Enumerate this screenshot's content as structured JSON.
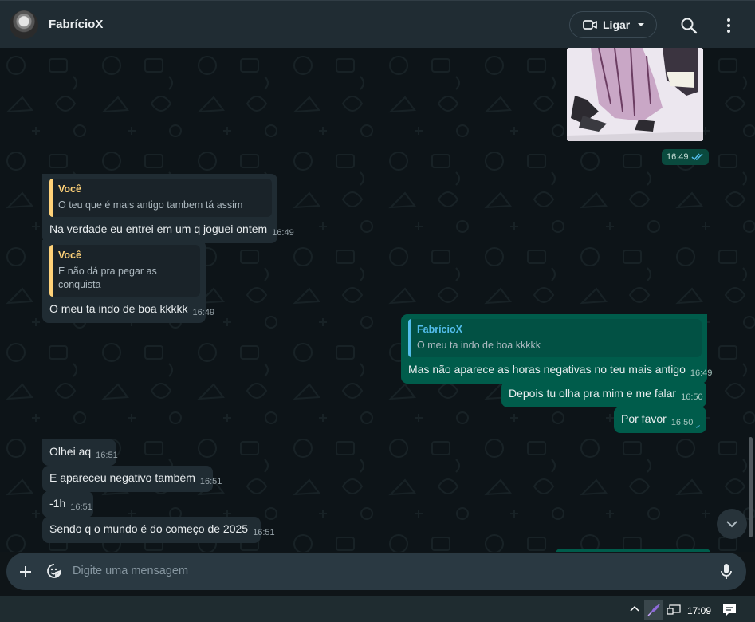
{
  "header": {
    "contact_name": "FabrícioX",
    "call_label": "Ligar",
    "icons": [
      "avatar",
      "video-camera-icon",
      "chevron-down-icon",
      "search-icon",
      "more-vertical-icon"
    ]
  },
  "messages": {
    "image_time": "16:49",
    "m1": {
      "quote_author": "Você",
      "quote_text": "O teu que é mais antigo tambem tá assim",
      "text": "Na verdade eu entrei em um q joguei ontem",
      "time": "16:49"
    },
    "m2": {
      "quote_author": "Você",
      "quote_text": "E não dá pra pegar as conquista",
      "text": "O meu ta indo de boa kkkkk",
      "time": "16:49"
    },
    "m3": {
      "quote_author": "FabrícioX",
      "quote_text": "O meu ta indo de boa kkkkk",
      "text": "Mas não aparece as horas negativas no teu mais antigo",
      "time": "16:49"
    },
    "m4": {
      "text": "Depois tu olha pra mim e me falar",
      "time": "16:50"
    },
    "m5": {
      "text": "Por favor",
      "time": "16:50"
    },
    "m6": {
      "text": "Olhei aq",
      "time": "16:51"
    },
    "m7": {
      "text": "E apareceu negativo também",
      "time": "16:51"
    },
    "m8": {
      "text": "-1h",
      "time": "16:51"
    },
    "m9": {
      "text": "Sendo q o mundo é do começo de 2025",
      "time": "16:51"
    }
  },
  "composer": {
    "placeholder": "Digite uma mensagem",
    "icons": [
      "plus-icon",
      "sticker-icon",
      "microphone-icon"
    ]
  },
  "taskbar": {
    "clock": "17:09",
    "icons": [
      "chevron-up-icon",
      "feather-icon",
      "network-icon",
      "notification-icon"
    ]
  },
  "colors": {
    "header_bg": "#202c33",
    "incoming_bubble": "#202c33",
    "outgoing_bubble": "#005c4b",
    "quote_you_accent": "#ffd279",
    "quote_contact_accent": "#53bdeb",
    "read_ticks": "#53bdeb"
  }
}
